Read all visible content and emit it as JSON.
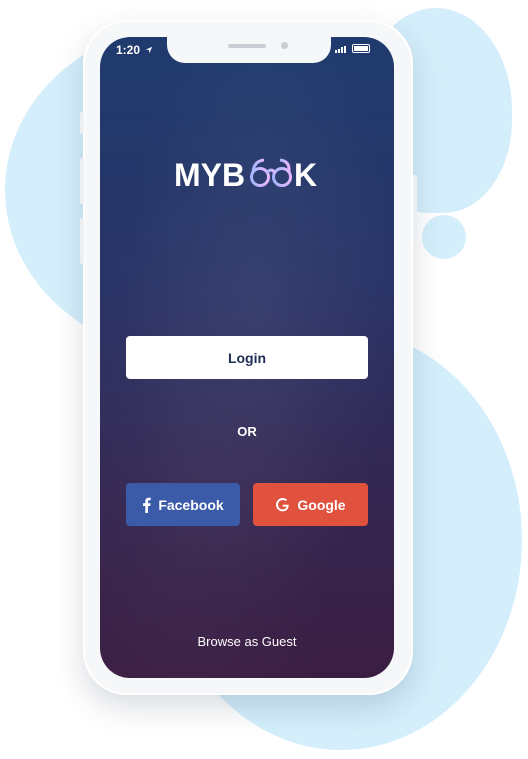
{
  "status_bar": {
    "time": "1:20"
  },
  "app": {
    "logo": "MYBOOK",
    "logo_parts": {
      "start": "MYB",
      "end": "K"
    },
    "login_label": "Login",
    "separator": "OR",
    "facebook_label": "Facebook",
    "google_label": "Google",
    "guest_label": "Browse as Guest"
  },
  "colors": {
    "background_blob": "#d4eefb",
    "screen_top": "#1f3b6e",
    "screen_bottom": "#3b1d42",
    "facebook": "#3b5ba8",
    "google": "#e0523e",
    "login_text": "#1f2d55",
    "logo_accent": "#a7b6ff"
  },
  "icons": [
    "location-arrow-icon",
    "signal-icon",
    "battery-icon",
    "glasses-icon",
    "facebook-icon",
    "google-icon"
  ]
}
